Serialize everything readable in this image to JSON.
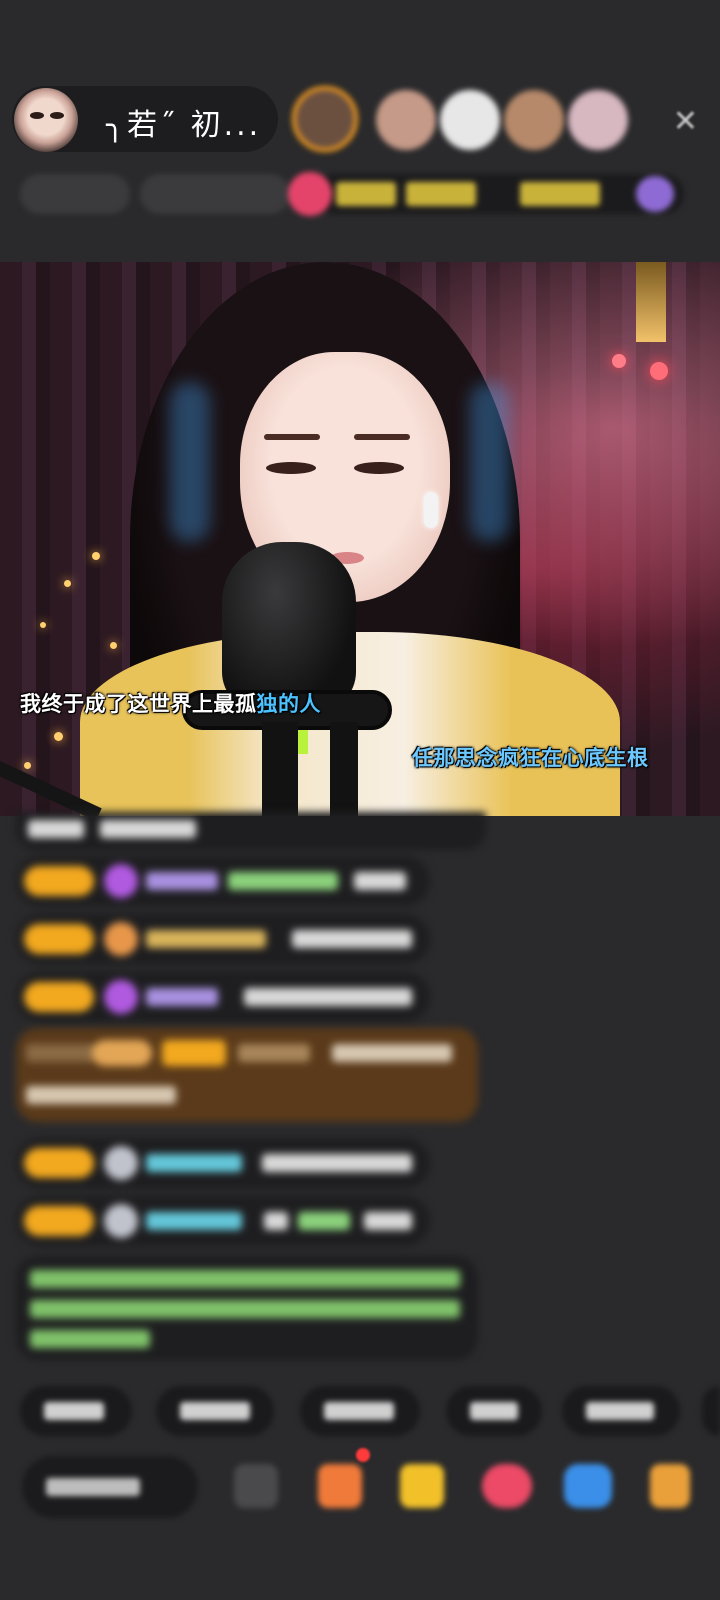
{
  "host": {
    "name": "╮若˝ 初..."
  },
  "header": {
    "close_symbol": "✕",
    "viewer_count": 5
  },
  "video": {
    "lyric_line_1": {
      "before": "我终于成了这世界上最孤",
      "highlight": "独的人"
    },
    "lyric_line_2": "任那思念疯狂在心底生根"
  },
  "icons": {
    "close": "close-icon",
    "gift": "gift-icon",
    "more": "more-icon"
  },
  "colors": {
    "background": "#2a2a2c",
    "badge": "#f2a81f",
    "lyric_highlight": "#4cc2ff"
  }
}
